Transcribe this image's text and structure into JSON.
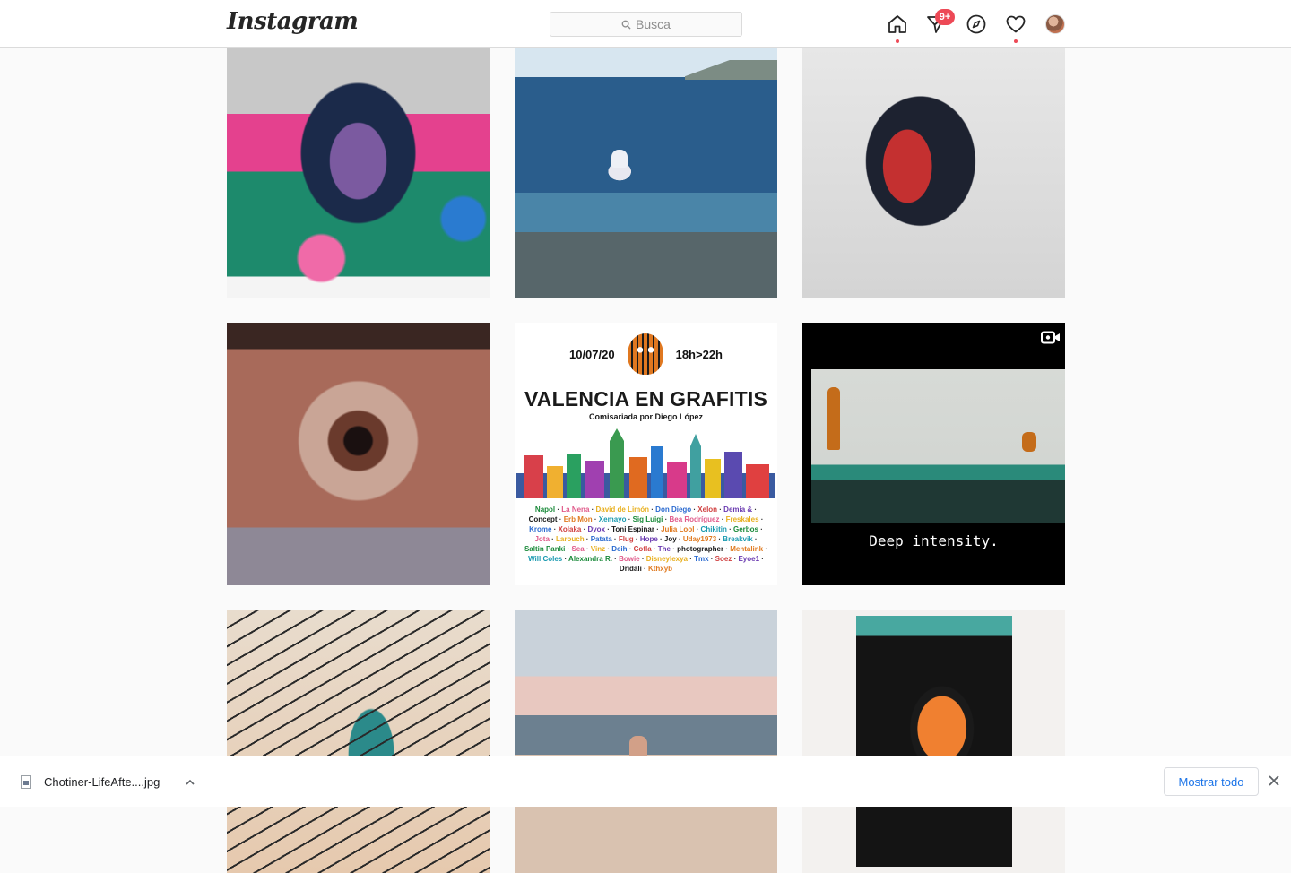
{
  "header": {
    "logo": "Instagram",
    "search_placeholder": "Busca",
    "notifications_badge": "9+"
  },
  "poster": {
    "date": "10/07/20",
    "time": "18h>22h",
    "title": "VALENCIA EN GRAFITIS",
    "subtitle": "Comisariada por Diego López",
    "artists": [
      "Napol",
      "La Nena",
      "David de Limón",
      "Don Diego",
      "Xelon",
      "Demia &",
      "Concept",
      "Erb Mon",
      "Xemayo",
      "Sig Luigi",
      "Bea Rodríguez",
      "Freskales",
      "Krome",
      "Xolaka",
      "Dyox",
      "Toni Espinar",
      "Julia Lool",
      "Chikitin",
      "Gerbos",
      "Jota",
      "Larouch",
      "Patata",
      "Flug",
      "Hope",
      "Joy",
      "Uday1973",
      "Breakvik",
      "Saltin Panki",
      "Sea",
      "Vinz",
      "Deih",
      "Cofla",
      "The",
      "photographer",
      "Mentalink",
      "Will Coles",
      "Alexandra R.",
      "Bowie",
      "Disneylexya",
      "Tmx",
      "Soez",
      "Eyoe1",
      "Dridali",
      "Kthxyb"
    ]
  },
  "video_post": {
    "caption": "Deep intensity."
  },
  "download_bar": {
    "file_name": "Chotiner-LifeAfte....jpg",
    "show_all": "Mostrar todo"
  },
  "colors": {
    "accent_red": "#ed4956",
    "link_blue": "#1a73e8",
    "border": "#dbdbdb"
  },
  "icons": [
    "home-icon",
    "direct-message-icon",
    "explore-icon",
    "heart-icon",
    "search-icon",
    "video-icon",
    "file-icon",
    "chevron-up-icon",
    "close-icon"
  ]
}
